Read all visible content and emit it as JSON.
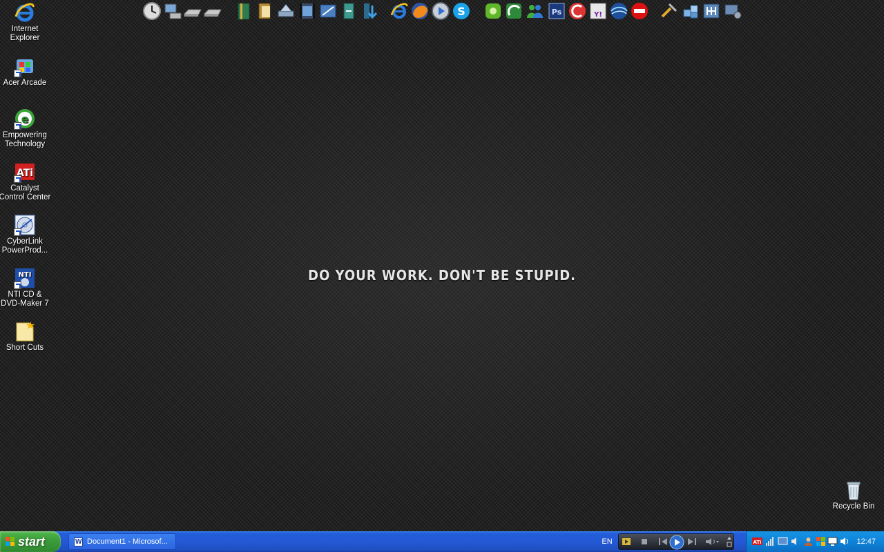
{
  "wallpaper": {
    "slogan": "DO YOUR WORK. DON'T BE STUPID."
  },
  "desktop_icons": [
    {
      "label": "Internet Explorer",
      "icon": "internet-explorer-icon"
    },
    {
      "label": "Acer Arcade",
      "icon": "acer-arcade-icon"
    },
    {
      "label": "Empowering Technology",
      "icon": "empowering-technology-icon"
    },
    {
      "label": "Catalyst Control Center",
      "icon": "ati-catalyst-icon"
    },
    {
      "label": "CyberLink PowerProd...",
      "icon": "cyberlink-disc-icon"
    },
    {
      "label": "NTI CD & DVD-Maker 7",
      "icon": "nti-cd-icon"
    },
    {
      "label": "Short Cuts",
      "icon": "folder-icon"
    },
    {
      "label": "Recycle Bin",
      "icon": "recycle-bin-icon"
    }
  ],
  "dock": {
    "icons": [
      "clock-icon",
      "my-computer-icon",
      "drive-icon",
      "drive-icon",
      "book-icon",
      "documents-icon",
      "scanner-icon",
      "film-icon",
      "mail-icon",
      "downloads-icon",
      "download-arrow-icon",
      "internet-explorer-icon",
      "firefox-icon",
      "media-player-icon",
      "skype-icon",
      "utorrent-icon",
      "bittorrent-icon",
      "messenger-icon",
      "photoshop-icon",
      "ccleaner-icon",
      "yahoo-icon",
      "google-earth-icon",
      "no-entry-icon",
      "tools-icon",
      "blocks-icon",
      "network-icon",
      "settings-icon"
    ]
  },
  "taskbar": {
    "start_label": "start",
    "task_label": "Document1 - Microsof...",
    "language": "EN",
    "clock": "12:47",
    "tray_icons": [
      "ati-tray-icon",
      "signal-icon",
      "network-tray-icon",
      "speaker-tray-icon",
      "user-tray-icon",
      "security-tray-icon",
      "display-tray-icon",
      "volume-icon"
    ]
  },
  "colors": {
    "taskbar_blue": "#245edb",
    "start_green": "#3c9b3b",
    "tray_blue": "#0f83d8",
    "wallpaper_dark": "#1e1e1e"
  }
}
